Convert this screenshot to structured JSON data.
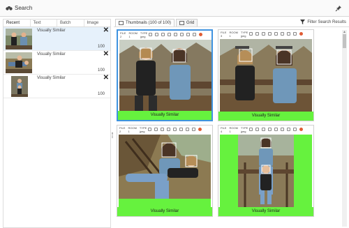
{
  "window": {
    "title": "Search"
  },
  "left_panel": {
    "tabs": [
      {
        "label": "Recent"
      },
      {
        "label": "Text"
      },
      {
        "label": "Batch"
      },
      {
        "label": "Image"
      }
    ],
    "results": [
      {
        "label": "Visually Similar",
        "score": "100",
        "close": "✕"
      },
      {
        "label": "Visually Similar",
        "score": "100",
        "close": "✕"
      },
      {
        "label": "Visually Similar",
        "score": "100",
        "close": "✕"
      }
    ]
  },
  "right_panel": {
    "view_tabs": [
      {
        "label": "Thumbnails (100 of 100)"
      },
      {
        "label": "Grid"
      }
    ],
    "filter_label": "Filter Search Results"
  },
  "cards": [
    {
      "meta": [
        [
          "FILE",
          "2"
        ],
        [
          "ROOM",
          "1"
        ],
        [
          "TYPE",
          "jpeg"
        ]
      ],
      "footer": "Visually Similar"
    },
    {
      "meta": [
        [
          "FILE",
          "3"
        ],
        [
          "ROOM",
          "1"
        ],
        [
          "TYPE",
          "jpeg"
        ]
      ],
      "footer": "Visually Similar"
    },
    {
      "meta": [
        [
          "FILE",
          "2"
        ],
        [
          "ROOM",
          "1"
        ],
        [
          "TYPE",
          "jpeg"
        ]
      ],
      "footer": "Visually Similar"
    },
    {
      "meta": [
        [
          "FILE",
          "4"
        ],
        [
          "ROOM",
          "1"
        ],
        [
          "TYPE",
          "jpeg"
        ]
      ],
      "footer": "Visually Similar"
    }
  ],
  "colors": {
    "selection": "#3f93e0",
    "match_green": "#66f23e",
    "selected_row": "#e6f1fb"
  },
  "icons": [
    "binoculars-icon",
    "pin-icon",
    "close-icon",
    "thumbnails-icon",
    "grid-icon",
    "filter-icon"
  ]
}
